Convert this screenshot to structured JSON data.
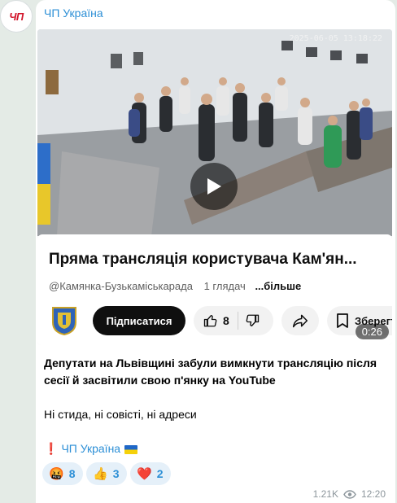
{
  "channel": {
    "avatar_text": "ЧП",
    "name": "ЧП Україна"
  },
  "video": {
    "overlay_timestamp": "2025-06-05 13:18:22",
    "duration": "0:26"
  },
  "youtube_card": {
    "title": "Пряма трансляція користувача Кам'ян...",
    "channel_handle": "@Камянка-Бузькаміськарада",
    "views": "1 глядач",
    "more_link": "...більше",
    "subscribe_label": "Підписатися",
    "like_count": "8",
    "save_label": "Зберегти"
  },
  "post": {
    "headline": "Депутати на Львівщині забули вимкнути трансляцію після сесії й засвітили свою п'янку на YouTube",
    "paragraph2": "Ні стида, ні совісті, ні адреси",
    "signature_mark": "❗",
    "signature_name": "ЧП Україна"
  },
  "reactions": [
    {
      "emoji": "🤬",
      "count": "8"
    },
    {
      "emoji": "👍",
      "count": "3"
    },
    {
      "emoji": "❤️",
      "count": "2"
    }
  ],
  "footer": {
    "views": "1.21K",
    "time": "12:20"
  },
  "icons": {
    "play": "play-icon",
    "like": "thumbs-up-icon",
    "dislike": "thumbs-down-icon",
    "share": "share-icon",
    "save": "bookmark-icon",
    "views": "eye-icon"
  },
  "colors": {
    "accent": "#2c8fd6",
    "brand_red": "#d2162b",
    "chat_background": "#e4ebe6"
  }
}
